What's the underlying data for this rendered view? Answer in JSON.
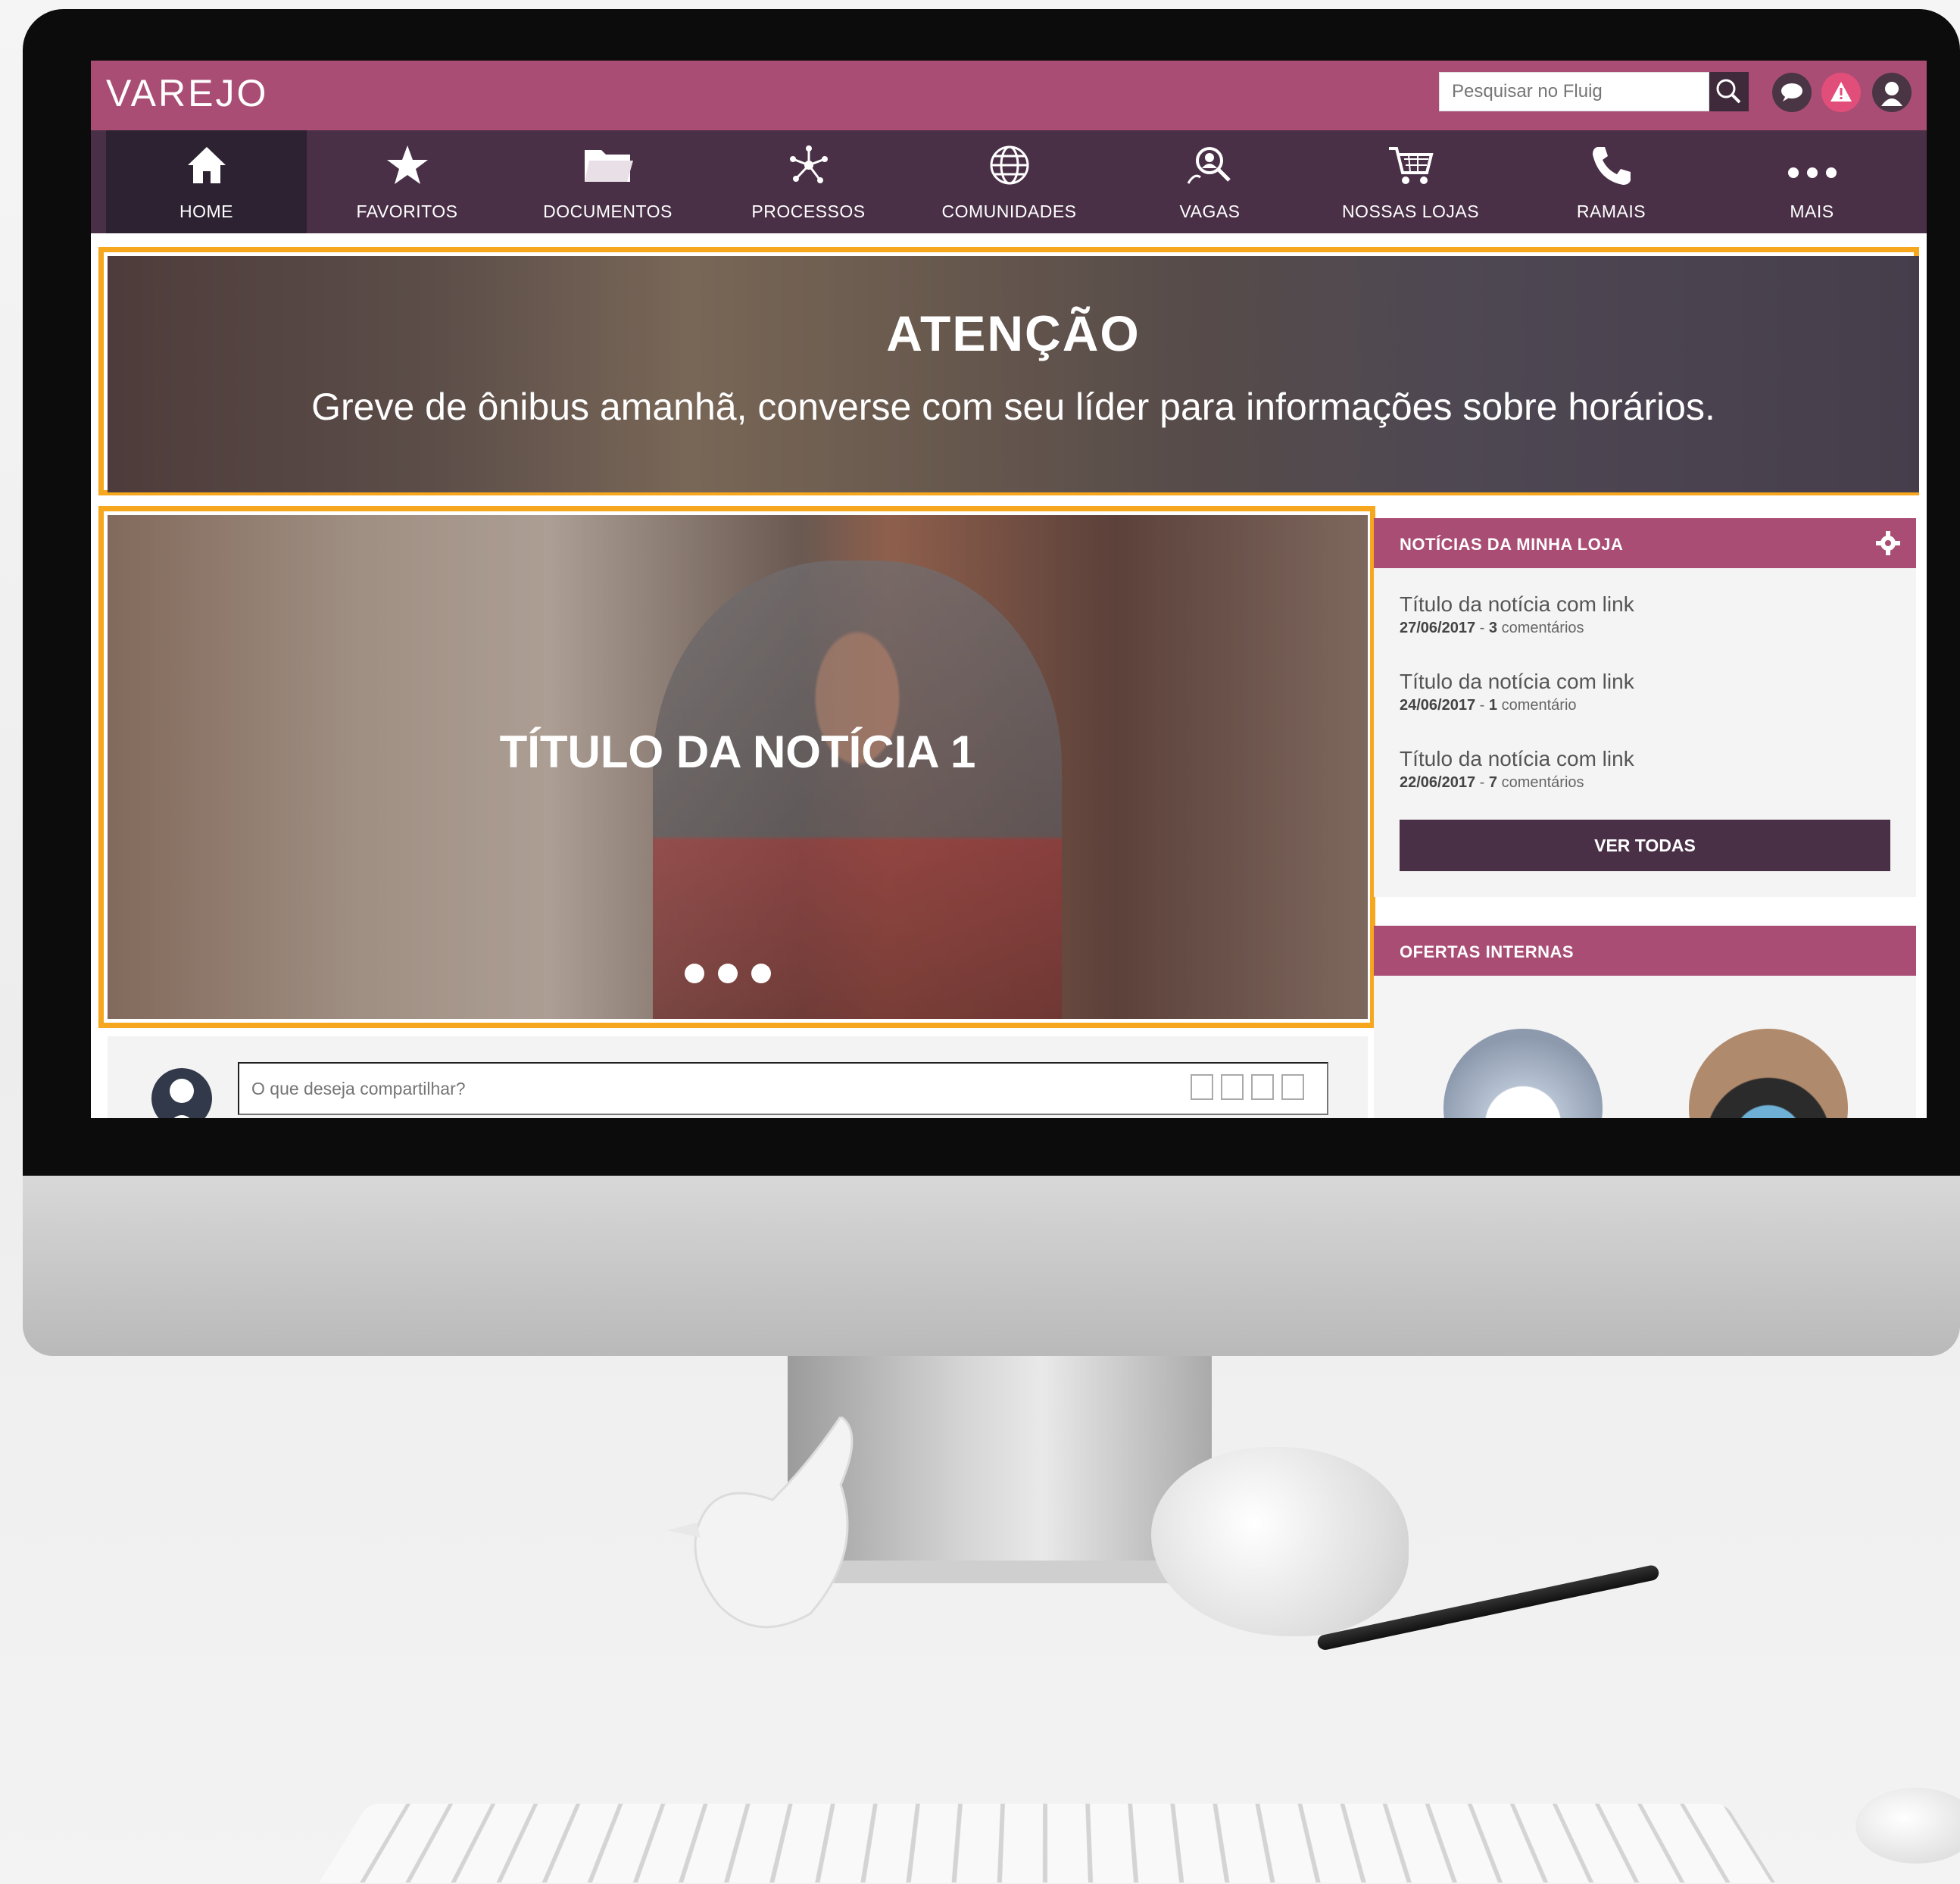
{
  "header": {
    "brand": "VAREJO",
    "search_placeholder": "Pesquisar no Fluig"
  },
  "nav": {
    "items": [
      {
        "label": "HOME",
        "icon": "home-icon"
      },
      {
        "label": "FAVORITOS",
        "icon": "star-icon"
      },
      {
        "label": "DOCUMENTOS",
        "icon": "folder-icon"
      },
      {
        "label": "PROCESSOS",
        "icon": "network-icon"
      },
      {
        "label": "COMUNIDADES",
        "icon": "globe-icon"
      },
      {
        "label": "VAGAS",
        "icon": "people-search-icon"
      },
      {
        "label": "NOSSAS LOJAS",
        "icon": "cart-icon"
      },
      {
        "label": "RAMAIS",
        "icon": "phone-icon"
      },
      {
        "label": "MAIS",
        "icon": "more-icon"
      }
    ],
    "active": "HOME"
  },
  "banner": {
    "title": "ATENÇÃO",
    "text": "Greve de ônibus amanhã, converse com seu líder para informações sobre horários."
  },
  "slider": {
    "title": "TÍTULO DA NOTÍCIA 1",
    "dots": 3
  },
  "post": {
    "placeholder": "O que deseja compartilhar?"
  },
  "news_panel": {
    "title": "NOTÍCIAS DA MINHA LOJA",
    "items": [
      {
        "title": "Título da notícia com link",
        "date": "27/06/2017",
        "count": "3",
        "label": "comentários"
      },
      {
        "title": "Título da notícia com link",
        "date": "24/06/2017",
        "count": "1",
        "label": "comentário"
      },
      {
        "title": "Título da notícia com link",
        "date": "22/06/2017",
        "count": "7",
        "label": "comentários"
      }
    ],
    "button": "VER TODAS"
  },
  "offers_panel": {
    "title": "OFERTAS INTERNAS"
  },
  "colors": {
    "topbar": "#a94d74",
    "navbar": "#4a3047",
    "highlight": "#f6a71d"
  }
}
